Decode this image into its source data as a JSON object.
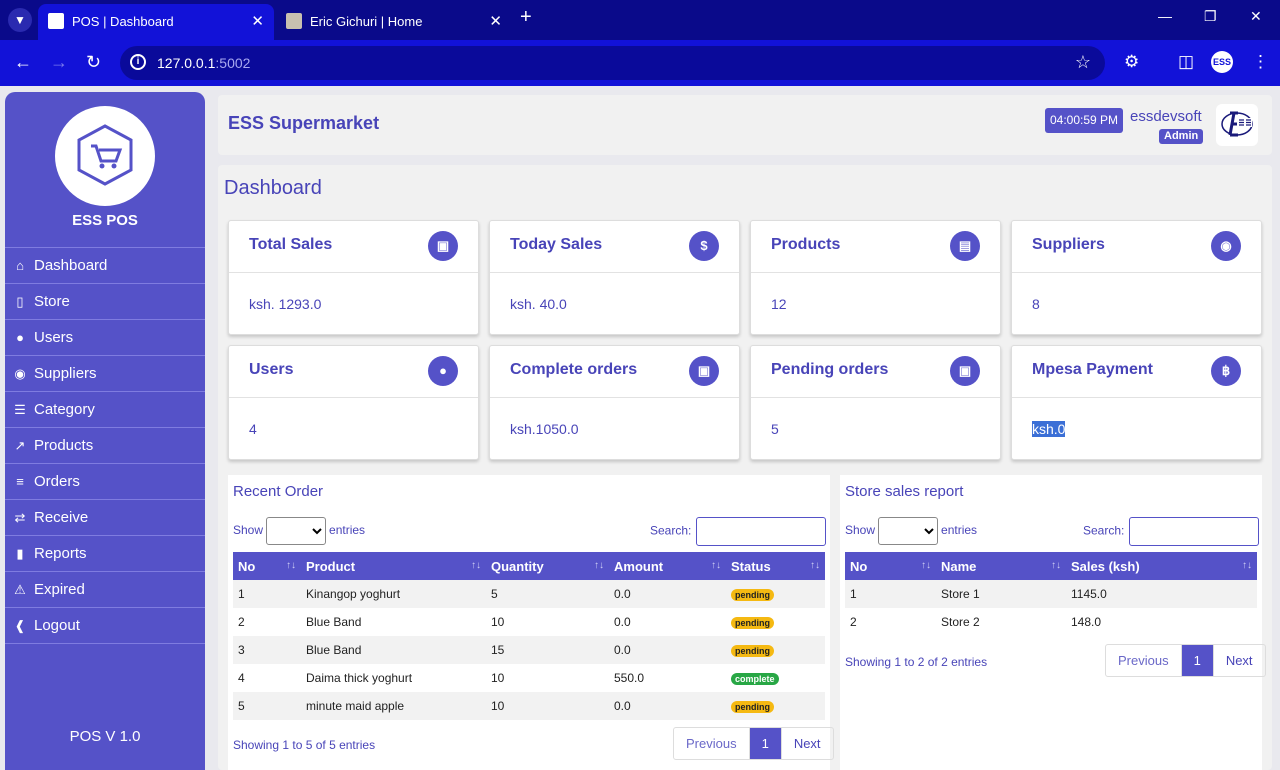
{
  "browser": {
    "tabs": [
      {
        "title": "POS | Dashboard"
      },
      {
        "title": "Eric Gichuri | Home"
      }
    ],
    "url_host": "127.0.0.1",
    "url_port": ":5002"
  },
  "sidebar": {
    "brand": "ESS POS",
    "items": [
      {
        "label": "Dashboard",
        "icon": "home-icon"
      },
      {
        "label": "Store",
        "icon": "store-icon"
      },
      {
        "label": "Users",
        "icon": "user-icon"
      },
      {
        "label": "Suppliers",
        "icon": "user-circle-icon"
      },
      {
        "label": "Category",
        "icon": "list-icon"
      },
      {
        "label": "Products",
        "icon": "chart-line-icon"
      },
      {
        "label": "Orders",
        "icon": "list-lines-icon"
      },
      {
        "label": "Receive",
        "icon": "exchange-icon"
      },
      {
        "label": "Reports",
        "icon": "file-icon"
      },
      {
        "label": "Expired",
        "icon": "warning-icon"
      },
      {
        "label": "Logout",
        "icon": "arrow-left-circle-icon"
      }
    ],
    "version": "POS V 1.0"
  },
  "header": {
    "store_name": "ESS Supermarket",
    "clock": "04:00:59 PM",
    "username": "essdevsoft",
    "role": "Admin"
  },
  "dashboard": {
    "title": "Dashboard",
    "cards": [
      {
        "title": "Total Sales",
        "value": "ksh. 1293.0",
        "icon": "money-icon"
      },
      {
        "title": "Today Sales",
        "value": "ksh. 40.0",
        "icon": "dollar-icon"
      },
      {
        "title": "Products",
        "value": "12",
        "icon": "cart-icon"
      },
      {
        "title": "Suppliers",
        "value": "8",
        "icon": "user-circle-icon"
      },
      {
        "title": "Users",
        "value": "4",
        "icon": "user-icon"
      },
      {
        "title": "Complete orders",
        "value": "ksh.1050.0",
        "icon": "money-icon"
      },
      {
        "title": "Pending orders",
        "value": "5",
        "icon": "money-icon"
      },
      {
        "title": "Mpesa Payment",
        "value": "ksh.0",
        "icon": "bitcoin-icon"
      }
    ]
  },
  "recent_orders": {
    "title": "Recent Order",
    "show_label": "Show",
    "entries_label": "entries",
    "search_label": "Search:",
    "columns": [
      "No",
      "Product",
      "Quantity",
      "Amount",
      "Status"
    ],
    "rows": [
      {
        "no": "1",
        "product": "Kinangop yoghurt",
        "quantity": "5",
        "amount": "0.0",
        "status": "pending"
      },
      {
        "no": "2",
        "product": "Blue Band",
        "quantity": "10",
        "amount": "0.0",
        "status": "pending"
      },
      {
        "no": "3",
        "product": "Blue Band",
        "quantity": "15",
        "amount": "0.0",
        "status": "pending"
      },
      {
        "no": "4",
        "product": "Daima thick yoghurt",
        "quantity": "10",
        "amount": "550.0",
        "status": "complete"
      },
      {
        "no": "5",
        "product": "minute maid apple",
        "quantity": "10",
        "amount": "0.0",
        "status": "pending"
      }
    ],
    "info": "Showing 1 to 5 of 5 entries",
    "pager": {
      "prev": "Previous",
      "page": "1",
      "next": "Next"
    }
  },
  "store_sales": {
    "title": "Store sales report",
    "show_label": "Show",
    "entries_label": "entries",
    "search_label": "Search:",
    "columns": [
      "No",
      "Name",
      "Sales (ksh)"
    ],
    "rows": [
      {
        "no": "1",
        "name": "Store 1",
        "sales": "1145.0"
      },
      {
        "no": "2",
        "name": "Store 2",
        "sales": "148.0"
      }
    ],
    "info": "Showing 1 to 2 of 2 entries",
    "pager": {
      "prev": "Previous",
      "page": "1",
      "next": "Next"
    }
  },
  "colors": {
    "brand": "#5552c8",
    "pending": "#f5b912",
    "complete": "#28a745",
    "chrome": "#1212d8"
  }
}
